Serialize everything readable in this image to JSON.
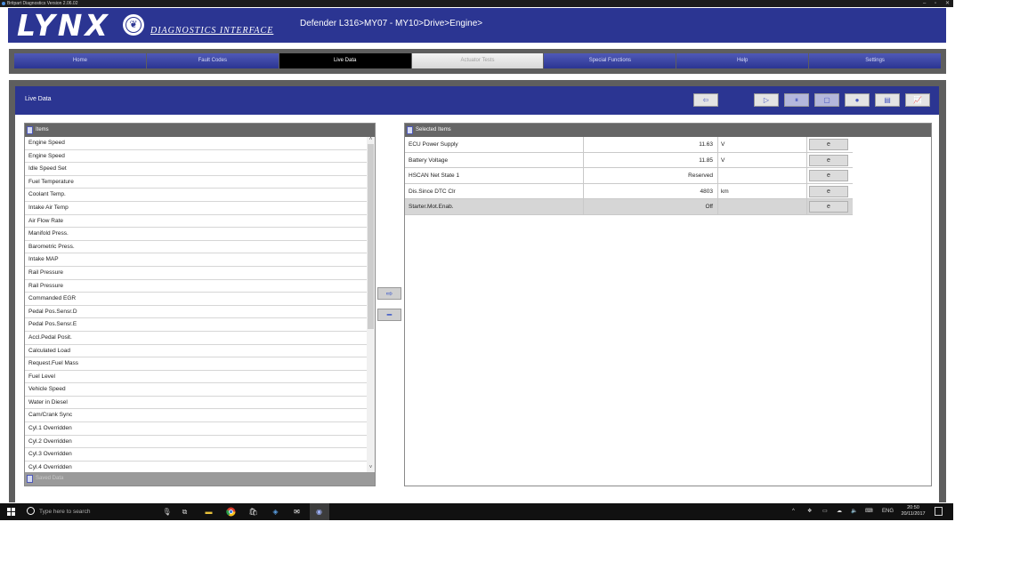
{
  "window": {
    "title": "Britpart Diagnostics Version 2.06.02",
    "minimize": "–",
    "maximize": "▫",
    "close": "✕"
  },
  "header": {
    "logo_text": "LYNX",
    "subtitle": "DIAGNOSTICS INTERFACE",
    "breadcrumb": "Defender L316>MY07 - MY10>Drive>Engine>"
  },
  "nav": {
    "tabs": [
      "Home",
      "Fault Codes",
      "Live Data",
      "Actuator Tests",
      "Special Functions",
      "Help",
      "Settings"
    ],
    "active": "Live Data",
    "disabled": "Actuator Tests"
  },
  "panel": {
    "title": "Live Data"
  },
  "toolbar": {
    "back": "⇦",
    "play": "▷",
    "pause": "⏸",
    "stop": "▢",
    "record": "●",
    "list": "▤",
    "graph": "📈"
  },
  "items_panel": {
    "title": "Items",
    "items": [
      "Engine Speed",
      "Engine Speed",
      "Idle Speed Set",
      "Fuel Temperature",
      "Coolant Temp.",
      "Intake Air Temp",
      "Air Flow Rate",
      "Manifold Press.",
      "Barometric Press.",
      "Intake MAP",
      "Rail Pressure",
      "Rail Pressure",
      "Commanded EGR",
      "Pedal Pos.Sensr.D",
      "Pedal Pos.Sensr.E",
      "Accl.Pedal Posit.",
      "Calculated Load",
      "Request.Fuel Mass",
      "Fuel Level",
      "Vehicle Speed",
      "Water in Diesel",
      "Cam/Crank Sync",
      "Cyl.1 Overridden",
      "Cyl.2 Overridden",
      "Cyl.3 Overridden",
      "Cyl.4 Overridden"
    ],
    "saved_data_label": "Saved Data",
    "scroll_up": "˄",
    "scroll_down": "˅"
  },
  "move_buttons": {
    "add": "⇨",
    "remove": "━"
  },
  "selected_panel": {
    "title": "Selected Items",
    "rows": [
      {
        "name": "ECU Power Supply",
        "value": "11.63",
        "unit": "V",
        "button": "e"
      },
      {
        "name": "Battery Voltage",
        "value": "11.85",
        "unit": "V",
        "button": "e"
      },
      {
        "name": "HSCAN Net State 1",
        "value": "Reserved",
        "unit": "",
        "button": "e"
      },
      {
        "name": "Dis.Since DTC Clr",
        "value": "4803",
        "unit": "km",
        "button": "e"
      },
      {
        "name": "Starter.Mot.Enab.",
        "value": "Off",
        "unit": "",
        "button": "e"
      }
    ]
  },
  "taskbar": {
    "search_placeholder": "Type here to search",
    "language": "ENG",
    "time": "20:50",
    "date": "20/11/2017",
    "tray_chevron": "^",
    "mic": "🎙",
    "task_view": "⧉"
  }
}
